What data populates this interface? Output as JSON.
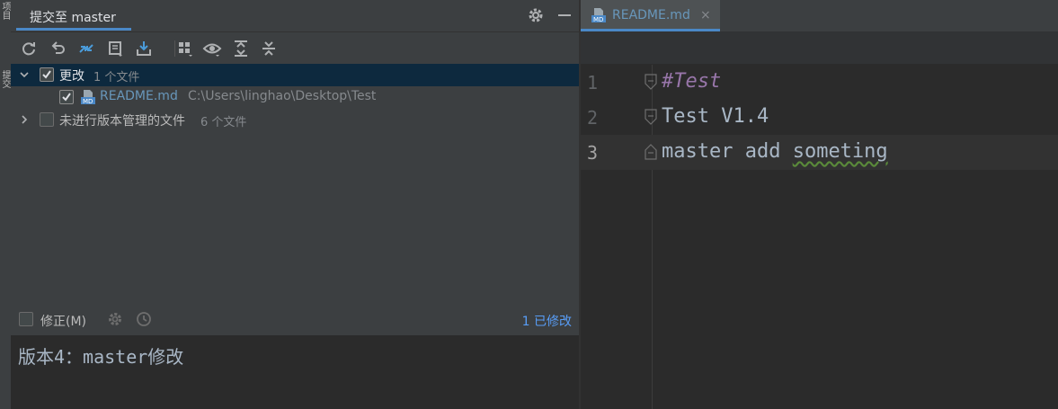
{
  "left_strip": {
    "tabs": [
      "项目",
      "提交"
    ]
  },
  "commit_panel": {
    "title": "提交至 master",
    "header_icons": [
      "gear-icon",
      "minimize-icon"
    ],
    "toolbar_icons": [
      "refresh-icon",
      "rollback-icon",
      "compare-arrows-icon",
      "show-diff-icon",
      "shelve-icon",
      "group-by-icon",
      "preview-eye-icon",
      "expand-all-icon",
      "collapse-all-icon"
    ],
    "tree": {
      "changes_label": "更改",
      "changes_count": "1 个文件",
      "file_name": "README.md",
      "file_path": "C:\\Users\\linghao\\Desktop\\Test",
      "unversioned_label": "未进行版本管理的文件",
      "unversioned_count": "6 个文件"
    },
    "amend_label": "修正(M)",
    "modified_link": "1 已修改",
    "commit_message": "版本4：master修改"
  },
  "editor": {
    "tab_label": "README.md",
    "tab_close": "×",
    "line_numbers": [
      "1",
      "2",
      "3"
    ],
    "lines": {
      "line1": "#Test",
      "line2": "Test V1.4",
      "line3_a": "master add ",
      "line3_b": "someting"
    }
  },
  "colors": {
    "accent": "#4a88c7",
    "link": "#589df6",
    "file_name": "#6897bb",
    "comment": "#9876aa"
  }
}
